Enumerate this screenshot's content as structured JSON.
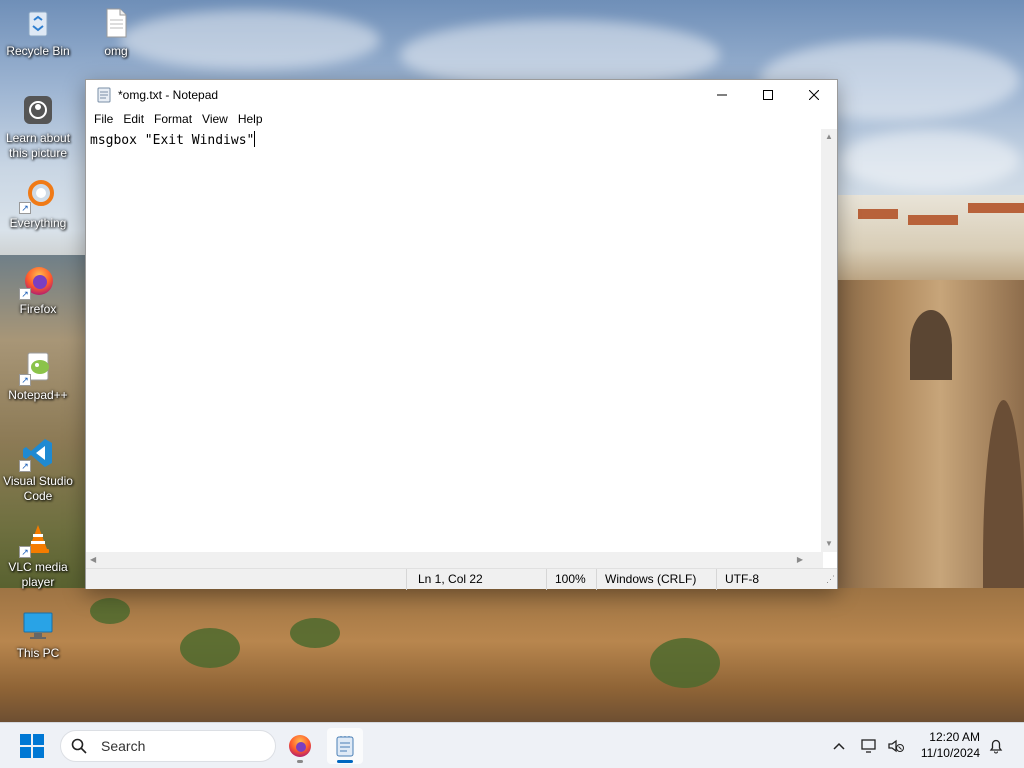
{
  "desktop": {
    "icons": [
      {
        "label": "Recycle Bin",
        "icon": "recycle-bin-icon"
      },
      {
        "label": "omg",
        "icon": "text-file-icon"
      },
      {
        "label": "Learn about this picture",
        "icon": "camera-icon"
      },
      {
        "label": "Everything",
        "icon": "everything-icon"
      },
      {
        "label": "Firefox",
        "icon": "firefox-icon"
      },
      {
        "label": "Notepad++",
        "icon": "notepadpp-icon"
      },
      {
        "label": "Visual Studio Code",
        "icon": "vscode-icon"
      },
      {
        "label": "VLC media player",
        "icon": "vlc-icon"
      },
      {
        "label": "This PC",
        "icon": "this-pc-icon"
      }
    ]
  },
  "notepad": {
    "title": "*omg.txt - Notepad",
    "menu": [
      "File",
      "Edit",
      "Format",
      "View",
      "Help"
    ],
    "content": "msgbox \"Exit Windiws\"",
    "status": {
      "position": "Ln 1, Col 22",
      "zoom": "100%",
      "line_ending": "Windows (CRLF)",
      "encoding": "UTF-8"
    }
  },
  "taskbar": {
    "search_placeholder": "Search",
    "time": "12:20 AM",
    "date": "11/10/2024",
    "apps": [
      "firefox-icon",
      "notepad-icon"
    ]
  },
  "colors": {
    "accent": "#0067c0",
    "taskbar_bg": "#eef1f6"
  }
}
